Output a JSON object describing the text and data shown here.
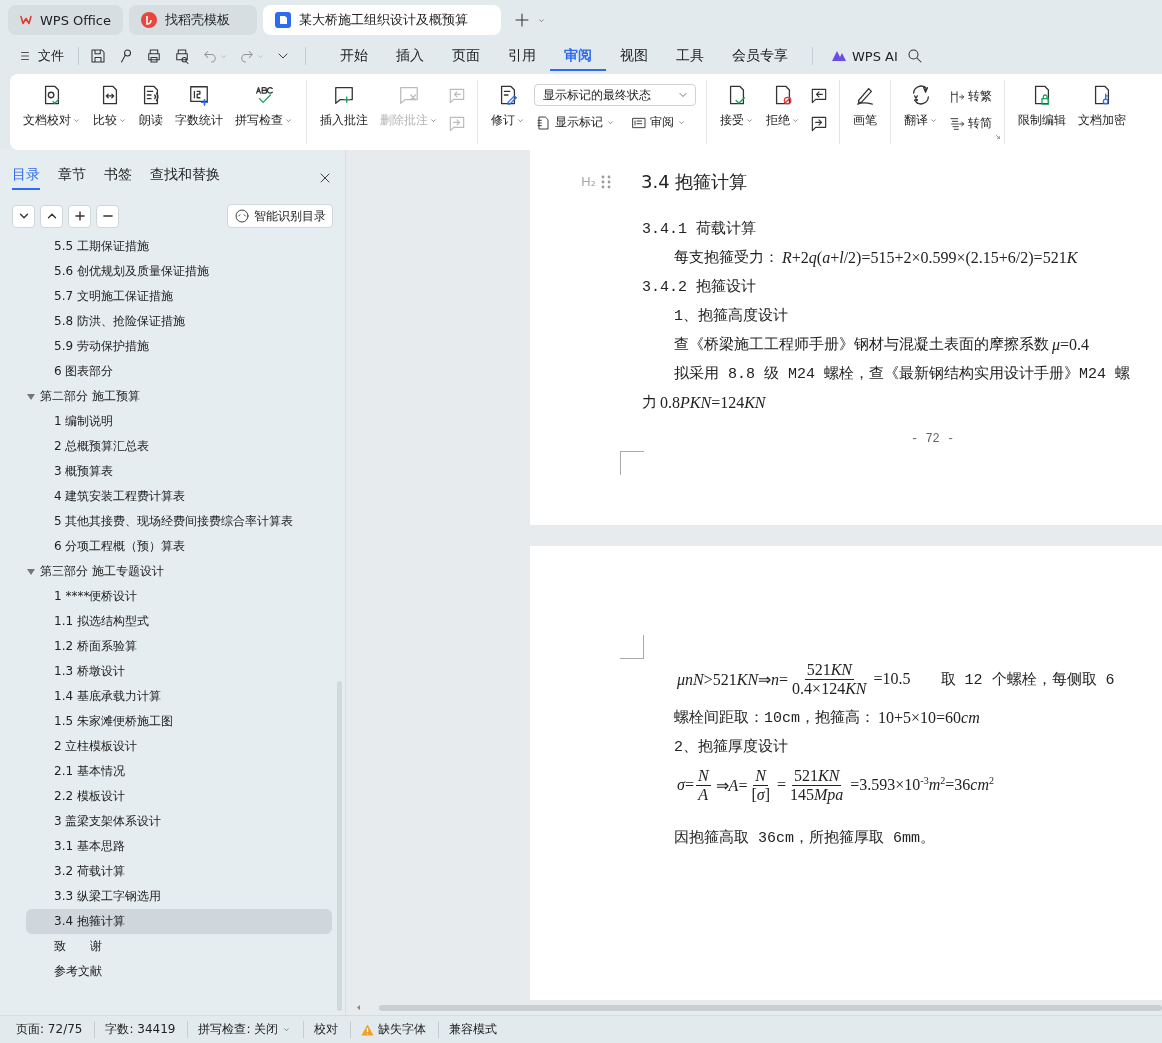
{
  "title_tabs": [
    {
      "label": "WPS Office",
      "selected": false
    },
    {
      "label": "找稻壳模板",
      "selected": false
    },
    {
      "label": "某大桥施工组织设计及概预算",
      "selected": true
    }
  ],
  "menu": {
    "file": "文件",
    "tabs": [
      {
        "label": "开始",
        "selected": false
      },
      {
        "label": "插入",
        "selected": false
      },
      {
        "label": "页面",
        "selected": false
      },
      {
        "label": "引用",
        "selected": false
      },
      {
        "label": "审阅",
        "selected": true
      },
      {
        "label": "视图",
        "selected": false
      },
      {
        "label": "工具",
        "selected": false
      },
      {
        "label": "会员专享",
        "selected": false
      }
    ],
    "ai": "WPS AI"
  },
  "ribbon": {
    "groups": [
      {
        "items": [
          {
            "kind": "large",
            "label": "文档校对",
            "dropdown": true,
            "disabled": false
          },
          {
            "kind": "large",
            "label": "比较",
            "dropdown": true,
            "disabled": false
          },
          {
            "kind": "large",
            "label": "朗读",
            "dropdown": false,
            "disabled": false
          },
          {
            "kind": "large",
            "label": "字数统计",
            "dropdown": false,
            "disabled": false
          },
          {
            "kind": "large",
            "label": "拼写检查",
            "dropdown": true,
            "disabled": false
          }
        ]
      },
      {
        "items": [
          {
            "kind": "large",
            "label": "插入批注",
            "dropdown": false,
            "disabled": false
          },
          {
            "kind": "large",
            "label": "删除批注",
            "dropdown": true,
            "disabled": true
          },
          {
            "kind": "icon_pair",
            "disabled": true
          }
        ]
      },
      {
        "items": [
          {
            "kind": "large",
            "label": "修订",
            "dropdown": true,
            "disabled": false
          },
          {
            "kind": "select_panel",
            "select": "显示标记的最终状态",
            "items": [
              {
                "label": "显示标记",
                "dropdown": true
              },
              {
                "label": "审阅",
                "dropdown": true
              }
            ]
          }
        ]
      },
      {
        "items": [
          {
            "kind": "large",
            "label": "接受",
            "dropdown": true,
            "disabled": false
          },
          {
            "kind": "large",
            "label": "拒绝",
            "dropdown": true,
            "disabled": false
          },
          {
            "kind": "icon_pair",
            "disabled": false
          }
        ]
      },
      {
        "items": [
          {
            "kind": "large",
            "label": "画笔",
            "dropdown": false,
            "disabled": false
          }
        ]
      },
      {
        "items": [
          {
            "kind": "large",
            "label": "翻译",
            "dropdown": true,
            "disabled": false
          },
          {
            "kind": "small_pair",
            "items": [
              {
                "label": "转繁"
              },
              {
                "label": "转简"
              }
            ]
          }
        ]
      },
      {
        "items": [
          {
            "kind": "large",
            "label": "限制编辑",
            "dropdown": false,
            "disabled": false
          },
          {
            "kind": "large",
            "label": "文档加密",
            "dropdown": false,
            "disabled": false
          }
        ]
      }
    ]
  },
  "sidebar": {
    "tabs": [
      {
        "label": "目录",
        "selected": true
      },
      {
        "label": "章节",
        "selected": false
      },
      {
        "label": "书签",
        "selected": false
      },
      {
        "label": "查找和替换",
        "selected": false
      }
    ],
    "smart_button": "智能识别目录",
    "toc": {
      "continued": [
        {
          "label": "5.5 工期保证措施",
          "selected": false
        },
        {
          "label": "5.6 创优规划及质量保证措施",
          "selected": false
        },
        {
          "label": "5.7 文明施工保证措施",
          "selected": false
        },
        {
          "label": "5.8 防洪、抢险保证措施",
          "selected": false
        },
        {
          "label": "5.9 劳动保护措施",
          "selected": false
        },
        {
          "label": "6 图表部分",
          "selected": false
        }
      ],
      "sections": [
        {
          "label": "第二部分 施工预算",
          "expanded": true,
          "selected": false,
          "children": [
            {
              "label": "1 编制说明",
              "selected": false
            },
            {
              "label": "2 总概预算汇总表",
              "selected": false
            },
            {
              "label": "3 概预算表",
              "selected": false
            },
            {
              "label": "4 建筑安装工程费计算表",
              "selected": false
            },
            {
              "label": "5 其他其接费、现场经费间接费综合率计算表",
              "selected": false
            },
            {
              "label": "6 分项工程概（预）算表",
              "selected": false
            }
          ]
        },
        {
          "label": "第三部分 施工专题设计",
          "expanded": true,
          "selected": false,
          "children": [
            {
              "label": "1 ****便桥设计",
              "selected": false
            },
            {
              "label": "1.1 拟选结构型式",
              "selected": false
            },
            {
              "label": "1.2 桥面系验算",
              "selected": false
            },
            {
              "label": "1.3 桥墩设计",
              "selected": false
            },
            {
              "label": "1.4 基底承载力计算",
              "selected": false
            },
            {
              "label": "1.5 朱家滩便桥施工图",
              "selected": false
            },
            {
              "label": "2 立柱模板设计",
              "selected": false
            },
            {
              "label": "2.1 基本情况",
              "selected": false
            },
            {
              "label": "2.2 模板设计",
              "selected": false
            },
            {
              "label": "3 盖梁支架体系设计",
              "selected": false
            },
            {
              "label": "3.1 基本思路",
              "selected": false
            },
            {
              "label": "3.2 荷载计算",
              "selected": false
            },
            {
              "label": "3.3 纵梁工字钢选用",
              "selected": false
            },
            {
              "label": "3.4 抱箍计算",
              "selected": true
            }
          ]
        }
      ],
      "trailing": [
        {
          "label": "致　　谢",
          "selected": false
        },
        {
          "label": "参考文献",
          "selected": false
        }
      ]
    }
  },
  "document": {
    "pages": [
      {
        "page_number": "- 72 -",
        "lines": [
          {
            "kind": "h2",
            "marker": "H₂",
            "parts": [
              {
                "kind": "text",
                "text": "3.4 抱箍计算"
              }
            ]
          },
          {
            "kind": "h3",
            "parts": [
              {
                "kind": "text",
                "text": "3.4.1 荷载计算"
              }
            ]
          },
          {
            "kind": "body",
            "parts": [
              {
                "kind": "text",
                "text": "每支抱箍受力："
              },
              {
                "kind": "math",
                "text": "R+2q(a+l/2)=515+2×0.599×(2.15+6/2)=521K"
              }
            ]
          },
          {
            "kind": "h3",
            "parts": [
              {
                "kind": "text",
                "text": "3.4.2 抱箍设计"
              }
            ]
          },
          {
            "kind": "body",
            "parts": [
              {
                "kind": "text",
                "text": "1、抱箍高度设计"
              }
            ]
          },
          {
            "kind": "body",
            "parts": [
              {
                "kind": "text",
                "text": "查《桥梁施工工程师手册》钢材与混凝土表面的摩擦系数"
              },
              {
                "kind": "math",
                "text": "μ=0.4"
              }
            ]
          },
          {
            "kind": "body",
            "parts": [
              {
                "kind": "text",
                "text": "拟采用 8.8 级 M24 螺栓，查《最新钢结构实用设计手册》M24 螺"
              }
            ]
          },
          {
            "kind": "flush",
            "parts": [
              {
                "kind": "text",
                "text": "力"
              },
              {
                "kind": "math",
                "text": "0.8PKN=124KN"
              }
            ]
          }
        ]
      },
      {
        "lines": [
          {
            "kind": "body",
            "parts": [
              {
                "kind": "math",
                "text": "μnN>521KN⇒n="
              },
              {
                "kind": "frac",
                "num": "521KN",
                "den": "0.4×124KN"
              },
              {
                "kind": "math",
                "text": "=10.5"
              },
              {
                "kind": "text",
                "text": "取 12 个螺栓，每侧取 6"
              }
            ]
          },
          {
            "kind": "body",
            "parts": [
              {
                "kind": "text",
                "text": "螺栓间距取：10cm，抱箍高："
              },
              {
                "kind": "math",
                "text": "10+5×10=60cm"
              }
            ]
          },
          {
            "kind": "body",
            "parts": [
              {
                "kind": "text",
                "text": "2、抱箍厚度设计"
              }
            ]
          },
          {
            "kind": "body",
            "parts": [
              {
                "kind": "math",
                "text": "σ="
              },
              {
                "kind": "frac",
                "num": "N",
                "den": "A"
              },
              {
                "kind": "math",
                "text": "⇒A="
              },
              {
                "kind": "frac",
                "num": "N",
                "den": "[σ]"
              },
              {
                "kind": "math",
                "text": "="
              },
              {
                "kind": "frac",
                "num": "521KN",
                "den": "145Mpa"
              },
              {
                "kind": "math",
                "text": "=3.593×10$^{-3}$m$^{2}$=36cm$^{2}$"
              }
            ]
          },
          {
            "kind": "body",
            "parts": [
              {
                "kind": "text",
                "text": "因抱箍高取 36cm，所抱箍厚取 6mm。"
              }
            ]
          }
        ]
      }
    ]
  },
  "status_bar": {
    "items": [
      {
        "kind": "text",
        "label": "页面: 72/75"
      },
      {
        "kind": "text",
        "label": "字数: 34419"
      },
      {
        "kind": "dropdown",
        "label": "拼写检查: 关闭"
      },
      {
        "kind": "text",
        "label": "校对"
      },
      {
        "kind": "warning",
        "label": "缺失字体"
      },
      {
        "kind": "text",
        "label": "兼容模式"
      }
    ]
  }
}
